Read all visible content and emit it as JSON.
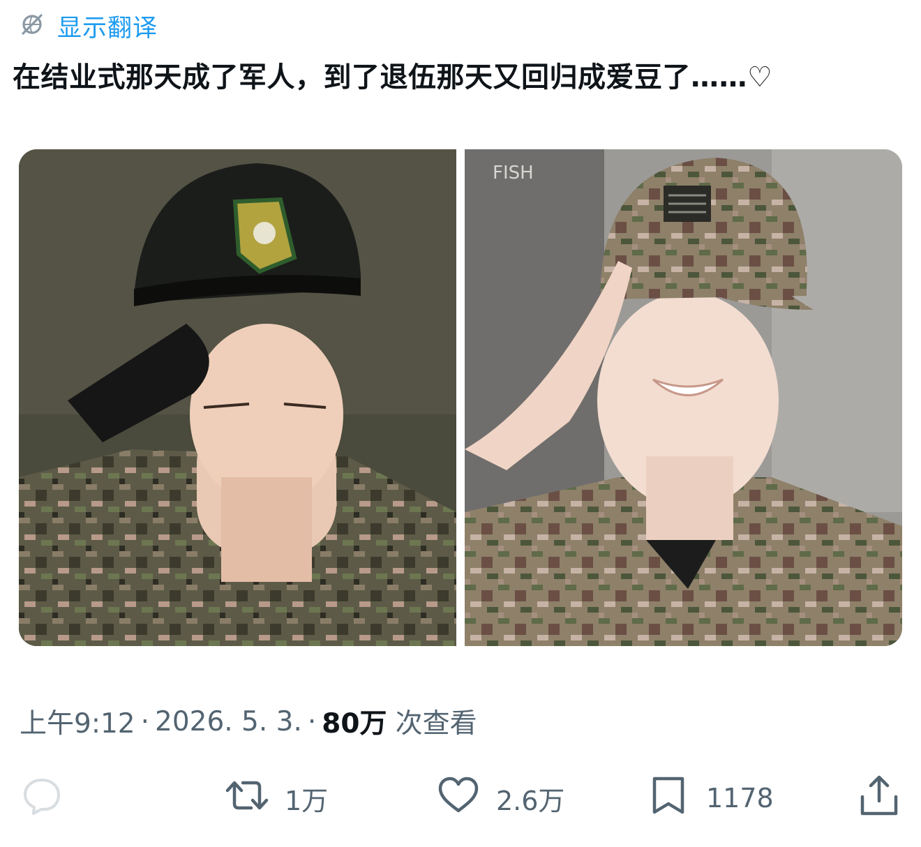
{
  "translate": {
    "label": "显示翻译",
    "icon": "globe-slash-icon"
  },
  "tweet": {
    "text": "在结业式那天成了军人，到了退伍那天又回归成爱豆了……♡"
  },
  "media": {
    "left_photo": {
      "icon": "photo"
    },
    "right_photo": {
      "icon": "photo",
      "overlay_text": "FISH"
    }
  },
  "meta": {
    "time": "上午9:12",
    "date": "2026. 5. 3.",
    "views_count": "80万",
    "views_label": "次查看"
  },
  "actions": {
    "reply": {
      "icon": "reply-bubble-icon"
    },
    "retweet": {
      "icon": "retweet-icon",
      "count": "1万"
    },
    "like": {
      "icon": "heart-icon",
      "count": "2.6万"
    },
    "bookmark": {
      "icon": "bookmark-icon",
      "count": "1178"
    },
    "share": {
      "icon": "share-upload-icon"
    }
  },
  "colors": {
    "accent": "#1d9bf0",
    "muted": "#536471",
    "text": "#0f1419"
  }
}
